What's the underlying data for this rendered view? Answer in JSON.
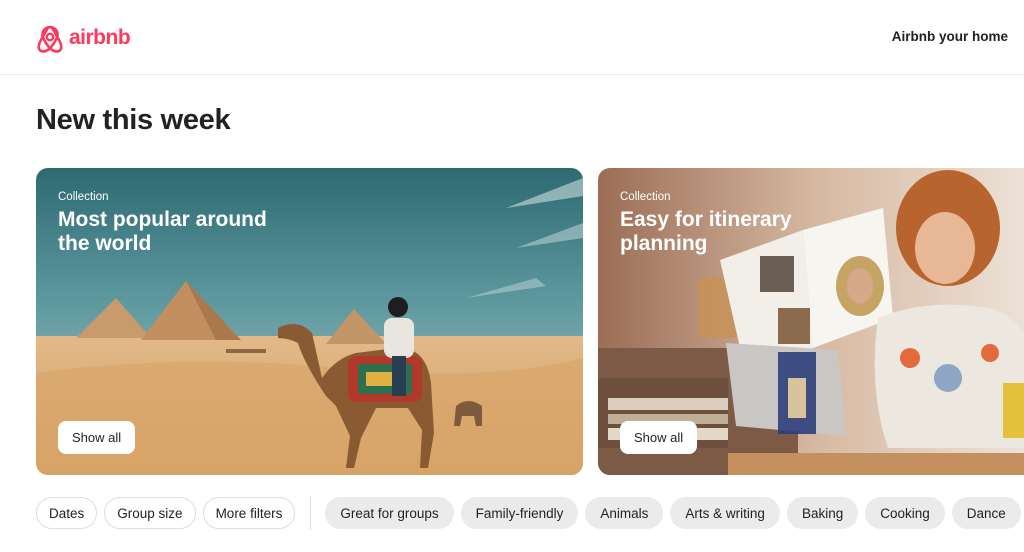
{
  "header": {
    "logo_text": "airbnb",
    "host_link": "Airbnb your home"
  },
  "main": {
    "section_title": "New this week",
    "cards": [
      {
        "kicker": "Collection",
        "title": "Most popular around the world",
        "button": "Show all"
      },
      {
        "kicker": "Collection",
        "title": "Easy for itinerary planning",
        "button": "Show all"
      }
    ]
  },
  "filters": {
    "buttons": [
      "Dates",
      "Group size",
      "More filters"
    ],
    "categories": [
      "Great for groups",
      "Family-friendly",
      "Animals",
      "Arts & writing",
      "Baking",
      "Cooking",
      "Dance"
    ]
  },
  "colors": {
    "brand": "#ff385c",
    "text": "#222222",
    "pill_border": "#dddddd",
    "pill_grey": "#ebebeb"
  },
  "icons": {
    "logo": "airbnb-belo-icon"
  }
}
